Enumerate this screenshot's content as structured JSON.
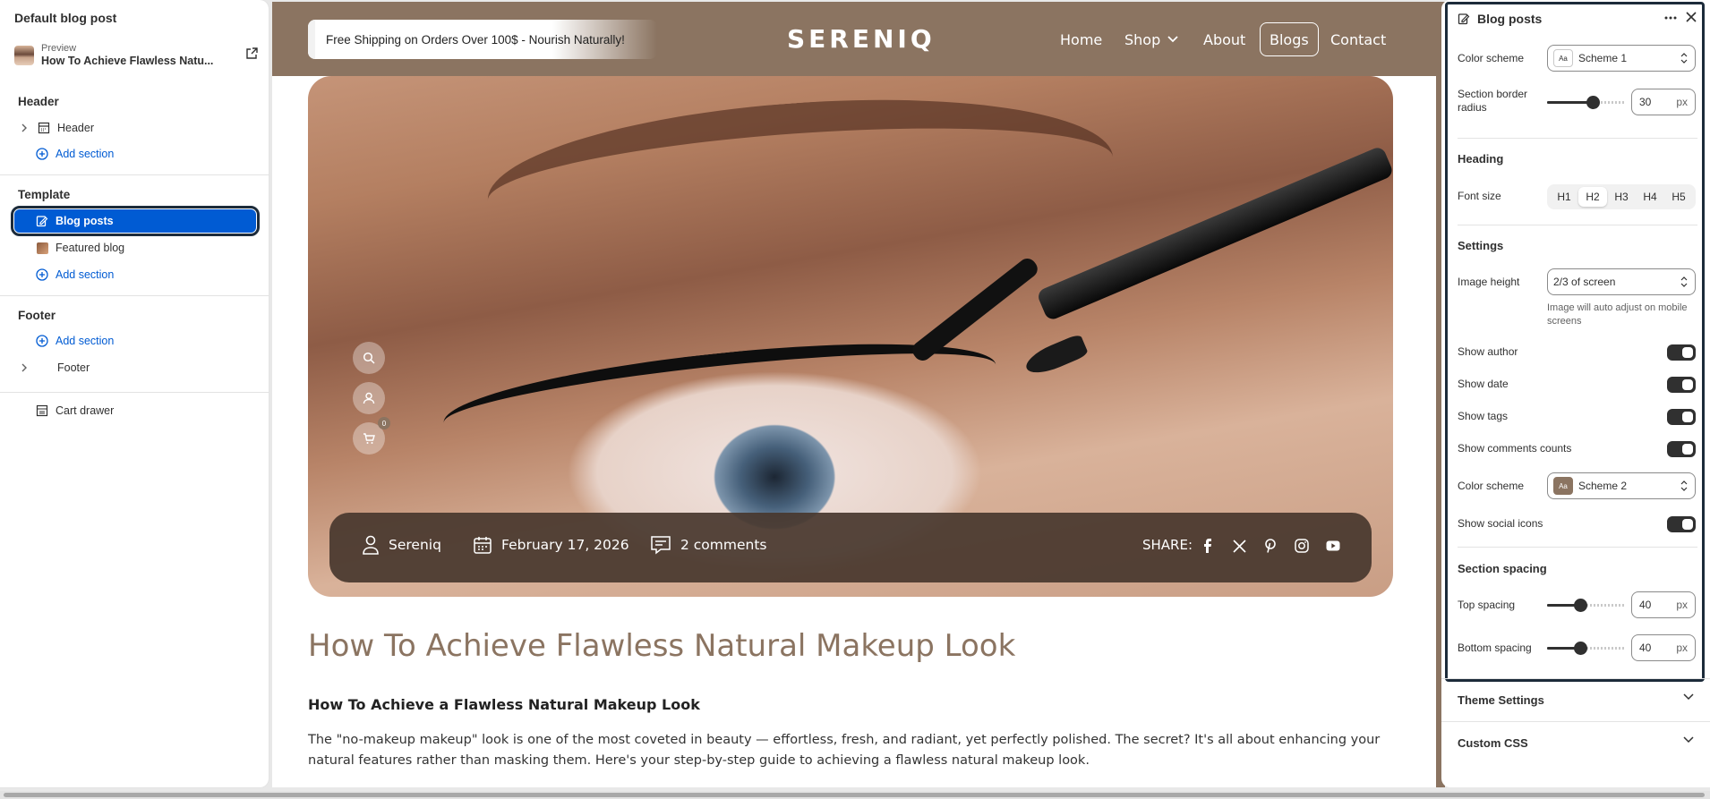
{
  "left": {
    "title": "Default blog post",
    "preview": {
      "label": "Preview",
      "name": "How To Achieve Flawless Natu..."
    },
    "header": {
      "title": "Header",
      "items": [
        {
          "label": "Header"
        }
      ],
      "add": "Add section"
    },
    "template": {
      "title": "Template",
      "selected": "Blog posts",
      "items": [
        {
          "label": "Featured blog"
        }
      ],
      "add": "Add section"
    },
    "footer": {
      "title": "Footer",
      "add": "Add section",
      "items": [
        {
          "label": "Footer"
        }
      ]
    },
    "cart": "Cart drawer"
  },
  "store": {
    "announcement": "Free Shipping on Orders Over 100$ - Nourish Naturally!",
    "logo": "SERENIQ",
    "nav": [
      "Home",
      "Shop",
      "About",
      "Blogs",
      "Contact"
    ],
    "active_nav": "Blogs",
    "cart_count": "0",
    "meta": {
      "author": "Sereniq",
      "date": "February 17, 2026",
      "comments": "2 comments",
      "share": "SHARE:"
    },
    "post_title": "How To Achieve Flawless Natural Makeup Look",
    "post_subtitle": "How To Achieve a Flawless Natural Makeup Look",
    "post_body": "The \"no-makeup makeup\" look is one of the most coveted in beauty — effortless, fresh, and radiant, yet perfectly polished. The secret? It's all about enhancing your natural features rather than masking them. Here's your step-by-step guide to achieving a flawless natural makeup look."
  },
  "panel": {
    "title": "Blog posts",
    "color_scheme_label": "Color scheme",
    "color_scheme_value": "Scheme 1",
    "border_radius_label": "Section border radius",
    "border_radius_value": "30",
    "unit": "px",
    "heading_title": "Heading",
    "font_size_label": "Font size",
    "font_sizes": [
      "H1",
      "H2",
      "H3",
      "H4",
      "H5"
    ],
    "font_size_selected": "H2",
    "settings_title": "Settings",
    "image_height_label": "Image height",
    "image_height_value": "2/3 of screen",
    "image_height_hint": "Image will auto adjust on mobile screens",
    "toggles": [
      "Show author",
      "Show date",
      "Show tags",
      "Show comments counts"
    ],
    "color_scheme2_label": "Color scheme",
    "color_scheme2_value": "Scheme 2",
    "social_label": "Show social icons",
    "spacing_title": "Section spacing",
    "top_spacing_label": "Top spacing",
    "top_spacing_value": "40",
    "bottom_spacing_label": "Bottom spacing",
    "bottom_spacing_value": "40",
    "theme_settings": "Theme Settings",
    "custom_css": "Custom CSS",
    "swatch_text": "Aa"
  },
  "colors": {
    "brand": "#8b7461",
    "selected": "#005bd3"
  }
}
